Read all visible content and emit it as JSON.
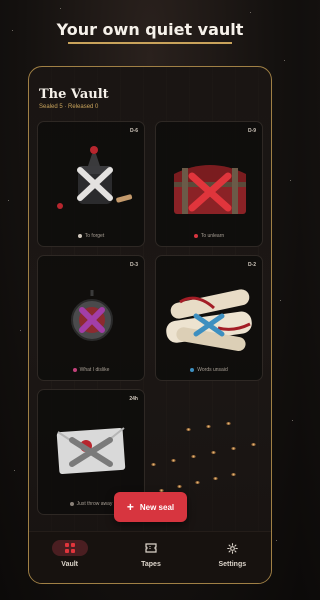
{
  "headline": "Your own quiet vault",
  "vault": {
    "title": "The Vault",
    "counts": "Sealed 5 · Released 0"
  },
  "cards": [
    {
      "tag": "D-6",
      "caption": "To forget",
      "dot_color": "#cfc6bb",
      "icon": "tied-sack-icon"
    },
    {
      "tag": "D-9",
      "caption": "To unlearn",
      "dot_color": "#d7353f",
      "icon": "treasure-chest-icon"
    },
    {
      "tag": "D-3",
      "caption": "What I dislike",
      "dot_color": "#c2417a",
      "icon": "medallion-icon"
    },
    {
      "tag": "D-2",
      "caption": "Words unsaid",
      "dot_color": "#3d8fc0",
      "icon": "scrolls-icon"
    },
    {
      "tag": "24h",
      "caption": "Just throw away",
      "dot_color": "#8a8178",
      "icon": "sealed-envelope-icon"
    }
  ],
  "fab": {
    "label": "New seal",
    "icon": "plus-icon"
  },
  "nav": {
    "items": [
      {
        "label": "Vault",
        "icon": "grid-icon",
        "active": true
      },
      {
        "label": "Tapes",
        "icon": "ticket-icon",
        "active": false
      },
      {
        "label": "Settings",
        "icon": "gear-icon",
        "active": false
      }
    ]
  },
  "colors": {
    "accent": "#c9a35b",
    "primary": "#d7353f",
    "background": "#14110f"
  }
}
